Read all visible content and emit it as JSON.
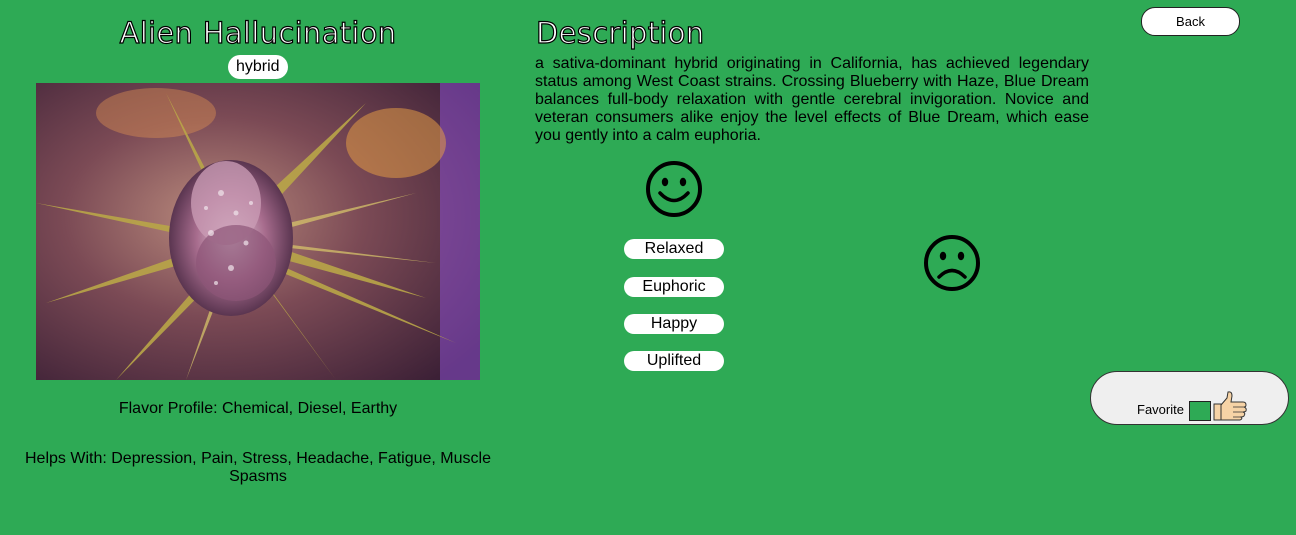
{
  "strain": {
    "name": "Alien Hallucination",
    "type": "hybrid",
    "image_alt": "cannabis-bud-photo",
    "flavor_profile": "Flavor Profile: Chemical, Diesel, Earthy",
    "helps_with": "Helps With: Depression, Pain, Stress, Headache, Fatigue, Muscle Spasms"
  },
  "description": {
    "title": "Description",
    "text": "a sativa-dominant hybrid originating in California, has achieved legendary status among West Coast strains. Crossing Blueberry with Haze, Blue Dream balances full-body relaxation with gentle cerebral invigoration. Novice and veteran consumers alike enjoy the level effects of Blue Dream, which ease you gently into a calm euphoria."
  },
  "effects": {
    "positive_icon": "smiley-face-icon",
    "negative_icon": "frown-face-icon",
    "positive": [
      "Relaxed",
      "Euphoric",
      "Happy",
      "Uplifted"
    ],
    "negative": []
  },
  "buttons": {
    "back": "Back",
    "favorite": "Favorite",
    "favorite_icon": "thumbs-up-icon"
  },
  "colors": {
    "background": "#2eaa55",
    "pill": "#ffffff",
    "favorite_bg": "#efefef"
  }
}
